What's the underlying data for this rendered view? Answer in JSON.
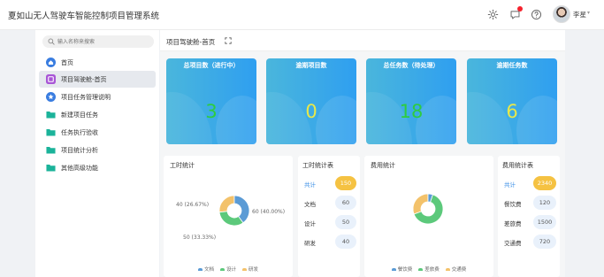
{
  "header": {
    "app_title": "夏如山无人驾驶车智能控制项目管理系统",
    "username": "李星",
    "icons": [
      "gear-icon",
      "notification-icon",
      "help-icon"
    ]
  },
  "sidebar": {
    "search_placeholder": "输入名称来搜索",
    "items": [
      {
        "label": "首页",
        "icon": "home-icon",
        "color": "#3a7de0"
      },
      {
        "label": "项目驾驶舱-首页",
        "icon": "dashboard-icon",
        "color": "#a855d6",
        "active": true
      },
      {
        "label": "项目任务管理说明",
        "icon": "task-icon",
        "color": "#3a7de0"
      },
      {
        "label": "新建项目任务",
        "icon": "folder-icon",
        "color": "#1bb39a"
      },
      {
        "label": "任务执行验收",
        "icon": "folder-icon",
        "color": "#1bb39a"
      },
      {
        "label": "项目统计分析",
        "icon": "folder-icon",
        "color": "#1bb39a"
      },
      {
        "label": "其他高级功能",
        "icon": "folder-icon",
        "color": "#1bb39a"
      }
    ]
  },
  "main": {
    "breadcrumb": "项目驾驶舱-首页",
    "stat_cards": [
      {
        "title": "总项目数（进行中）",
        "value": "3",
        "value_color": "#2ecc40"
      },
      {
        "title": "逾期项目数",
        "value": "0",
        "value_color": "#e8e84a"
      },
      {
        "title": "总任务数（待处理）",
        "value": "18",
        "value_color": "#2ecc40"
      },
      {
        "title": "逾期任务数",
        "value": "6",
        "value_color": "#e8e84a"
      }
    ],
    "hours_chart": {
      "title": "工时统计",
      "labels": [
        "40 (26.67%)",
        "60 (40.00%)",
        "50 (33.33%)"
      ],
      "legend": [
        "文档",
        "设计",
        "研发"
      ]
    },
    "hours_table": {
      "title": "工时统计表",
      "rows": [
        {
          "label": "共计",
          "value": "150"
        },
        {
          "label": "文档",
          "value": "60"
        },
        {
          "label": "设计",
          "value": "50"
        },
        {
          "label": "研发",
          "value": "40"
        }
      ]
    },
    "cost_chart": {
      "title": "费用统计",
      "legend": [
        "餐饮费",
        "差旅费",
        "交通费"
      ]
    },
    "cost_table": {
      "title": "费用统计表",
      "rows": [
        {
          "label": "共计",
          "value": "2340"
        },
        {
          "label": "餐饮费",
          "value": "120"
        },
        {
          "label": "差旅费",
          "value": "1500"
        },
        {
          "label": "交通费",
          "value": "720"
        }
      ]
    }
  },
  "chart_data": [
    {
      "type": "pie",
      "title": "工时统计",
      "categories": [
        "文档",
        "设计",
        "研发"
      ],
      "values": [
        60,
        50,
        40
      ],
      "percent_labels": [
        "40.00%",
        "33.33%",
        "26.67%"
      ],
      "colors": [
        "#5b9bd5",
        "#5cc97b",
        "#f3c26b"
      ],
      "donut": true,
      "legend_position": "bottom"
    },
    {
      "type": "pie",
      "categories": [
        "餐饮费",
        "差旅费",
        "交通费"
      ],
      "values": [
        120,
        1500,
        720
      ],
      "colors": [
        "#5b9bd5",
        "#5cc97b",
        "#f3c26b"
      ],
      "donut": true,
      "legend_position": "bottom"
    }
  ]
}
